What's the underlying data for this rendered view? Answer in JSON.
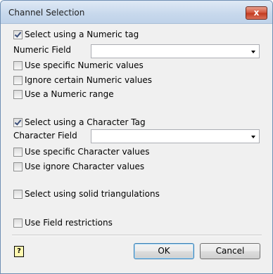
{
  "window": {
    "title": "Channel Selection",
    "close_glyph": "x"
  },
  "numeric": {
    "select_label": "Select using a Numeric tag",
    "select_checked": true,
    "field_label": "Numeric Field",
    "field_value": "",
    "options": [
      {
        "label": "Use specific Numeric values",
        "checked": false
      },
      {
        "label": "Ignore certain Numeric values",
        "checked": false
      },
      {
        "label": "Use a Numeric range",
        "checked": false
      }
    ]
  },
  "character": {
    "select_label": "Select using a Character Tag",
    "select_checked": true,
    "field_label": "Character Field",
    "field_value": "",
    "options": [
      {
        "label": "Use specific Character values",
        "checked": false
      },
      {
        "label": "Use ignore Character values",
        "checked": false
      }
    ]
  },
  "solid": {
    "label": "Select using solid triangulations",
    "checked": false
  },
  "restrictions": {
    "label": "Use Field restrictions",
    "checked": false
  },
  "footer": {
    "help_glyph": "?",
    "ok_label": "OK",
    "cancel_label": "Cancel"
  },
  "icons": {
    "help": "help-icon",
    "dropdown": "chevron-down-icon",
    "checkmark": "checkmark-icon"
  }
}
